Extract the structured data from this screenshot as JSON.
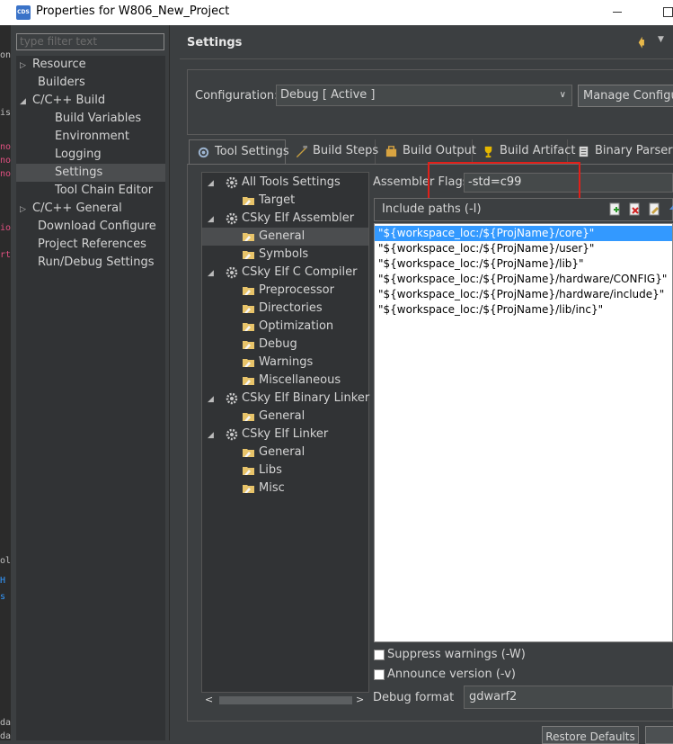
{
  "window": {
    "title": "Properties for W806_New_Project",
    "app_icon_text": "CDS"
  },
  "nav": {
    "filter_placeholder": "type filter text",
    "items": [
      {
        "label": "Resource",
        "arrow": "▷"
      },
      {
        "label": "Builders"
      },
      {
        "label": "C/C++ Build",
        "arrow": "◢"
      },
      {
        "label": "Build Variables"
      },
      {
        "label": "Environment"
      },
      {
        "label": "Logging"
      },
      {
        "label": "Settings"
      },
      {
        "label": "Tool Chain Editor"
      },
      {
        "label": "C/C++ General",
        "arrow": "▷"
      },
      {
        "label": "Download Configure"
      },
      {
        "label": "Project References"
      },
      {
        "label": "Run/Debug Settings"
      }
    ]
  },
  "header": {
    "title": "Settings"
  },
  "configuration": {
    "label": "Configuration:",
    "value": "Debug  [ Active ]",
    "manage_button": "Manage Configurations..."
  },
  "tabs": [
    {
      "label": "Tool Settings",
      "icon": "tool-settings-icon"
    },
    {
      "label": "Build Steps",
      "icon": "build-steps-icon"
    },
    {
      "label": "Build Output",
      "icon": "build-output-icon"
    },
    {
      "label": "Build Artifact",
      "icon": "build-artifact-icon"
    },
    {
      "label": "Binary Parsers",
      "icon": "binary-parsers-icon"
    }
  ],
  "tool_tree": [
    {
      "label": "All Tools Settings"
    },
    {
      "label": "Target"
    },
    {
      "label": "CSky Elf Assembler"
    },
    {
      "label": "General"
    },
    {
      "label": "Symbols"
    },
    {
      "label": "CSky Elf C Compiler"
    },
    {
      "label": "Preprocessor"
    },
    {
      "label": "Directories"
    },
    {
      "label": "Optimization"
    },
    {
      "label": "Debug"
    },
    {
      "label": "Warnings"
    },
    {
      "label": "Miscellaneous"
    },
    {
      "label": "CSky Elf Binary Linker"
    },
    {
      "label": "General"
    },
    {
      "label": "CSky Elf Linker"
    },
    {
      "label": "General"
    },
    {
      "label": "Libs"
    },
    {
      "label": "Misc"
    }
  ],
  "assembler": {
    "flags_label": "Assembler Flags",
    "flags_value": "-std=c99",
    "include_label": "Include paths (-I)",
    "include_paths": [
      "\"${workspace_loc:/${ProjName}/core}\"",
      "\"${workspace_loc:/${ProjName}/user}\"",
      "\"${workspace_loc:/${ProjName}/lib}\"",
      "\"${workspace_loc:/${ProjName}/hardware/CONFIG}\"",
      "\"${workspace_loc:/${ProjName}/hardware/include}\"",
      "\"${workspace_loc:/${ProjName}/lib/inc}\""
    ],
    "suppress_warnings": "Suppress warnings (-W)",
    "announce_version": "Announce version (-v)",
    "debug_format_label": "Debug format",
    "debug_format_value": "gdwarf2"
  },
  "footer": {
    "restore_defaults": "Restore Defaults"
  },
  "colors": {
    "selection": "#3399ff",
    "highlight_box": "#e0201a",
    "accent_arrow": "#e8b84a"
  }
}
